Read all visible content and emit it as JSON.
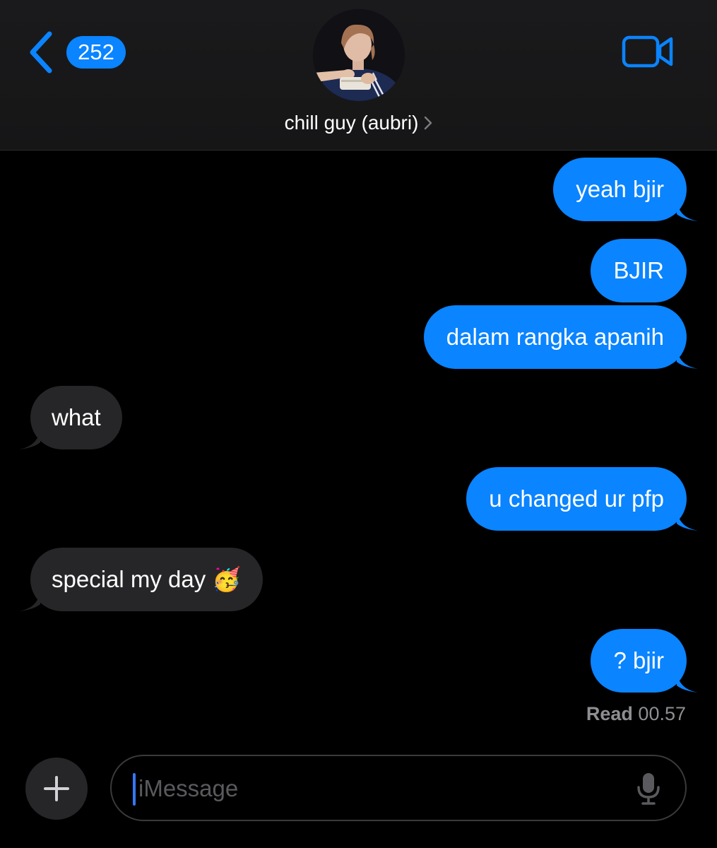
{
  "header": {
    "unread_count": "252",
    "contact_name": "chill guy (aubri)"
  },
  "messages": [
    {
      "direction": "outgoing",
      "text": "yeah bjir"
    },
    {
      "direction": "outgoing",
      "text": "BJIR"
    },
    {
      "direction": "outgoing",
      "text": "dalam rangka apanih"
    },
    {
      "direction": "incoming",
      "text": "what"
    },
    {
      "direction": "outgoing",
      "text": "u changed ur pfp"
    },
    {
      "direction": "incoming",
      "text": "special my day 🥳"
    },
    {
      "direction": "outgoing",
      "text": "? bjir"
    }
  ],
  "receipt": {
    "label": "Read",
    "time": "00.57"
  },
  "composer": {
    "placeholder": "iMessage"
  },
  "icons": {
    "back": "chevron-left-icon",
    "video": "video-camera-icon",
    "plus": "plus-icon",
    "mic": "microphone-icon",
    "name_chevron": "chevron-right-icon"
  },
  "colors": {
    "accent": "#0a84ff",
    "incoming_bubble": "#262628",
    "background": "#000000"
  }
}
